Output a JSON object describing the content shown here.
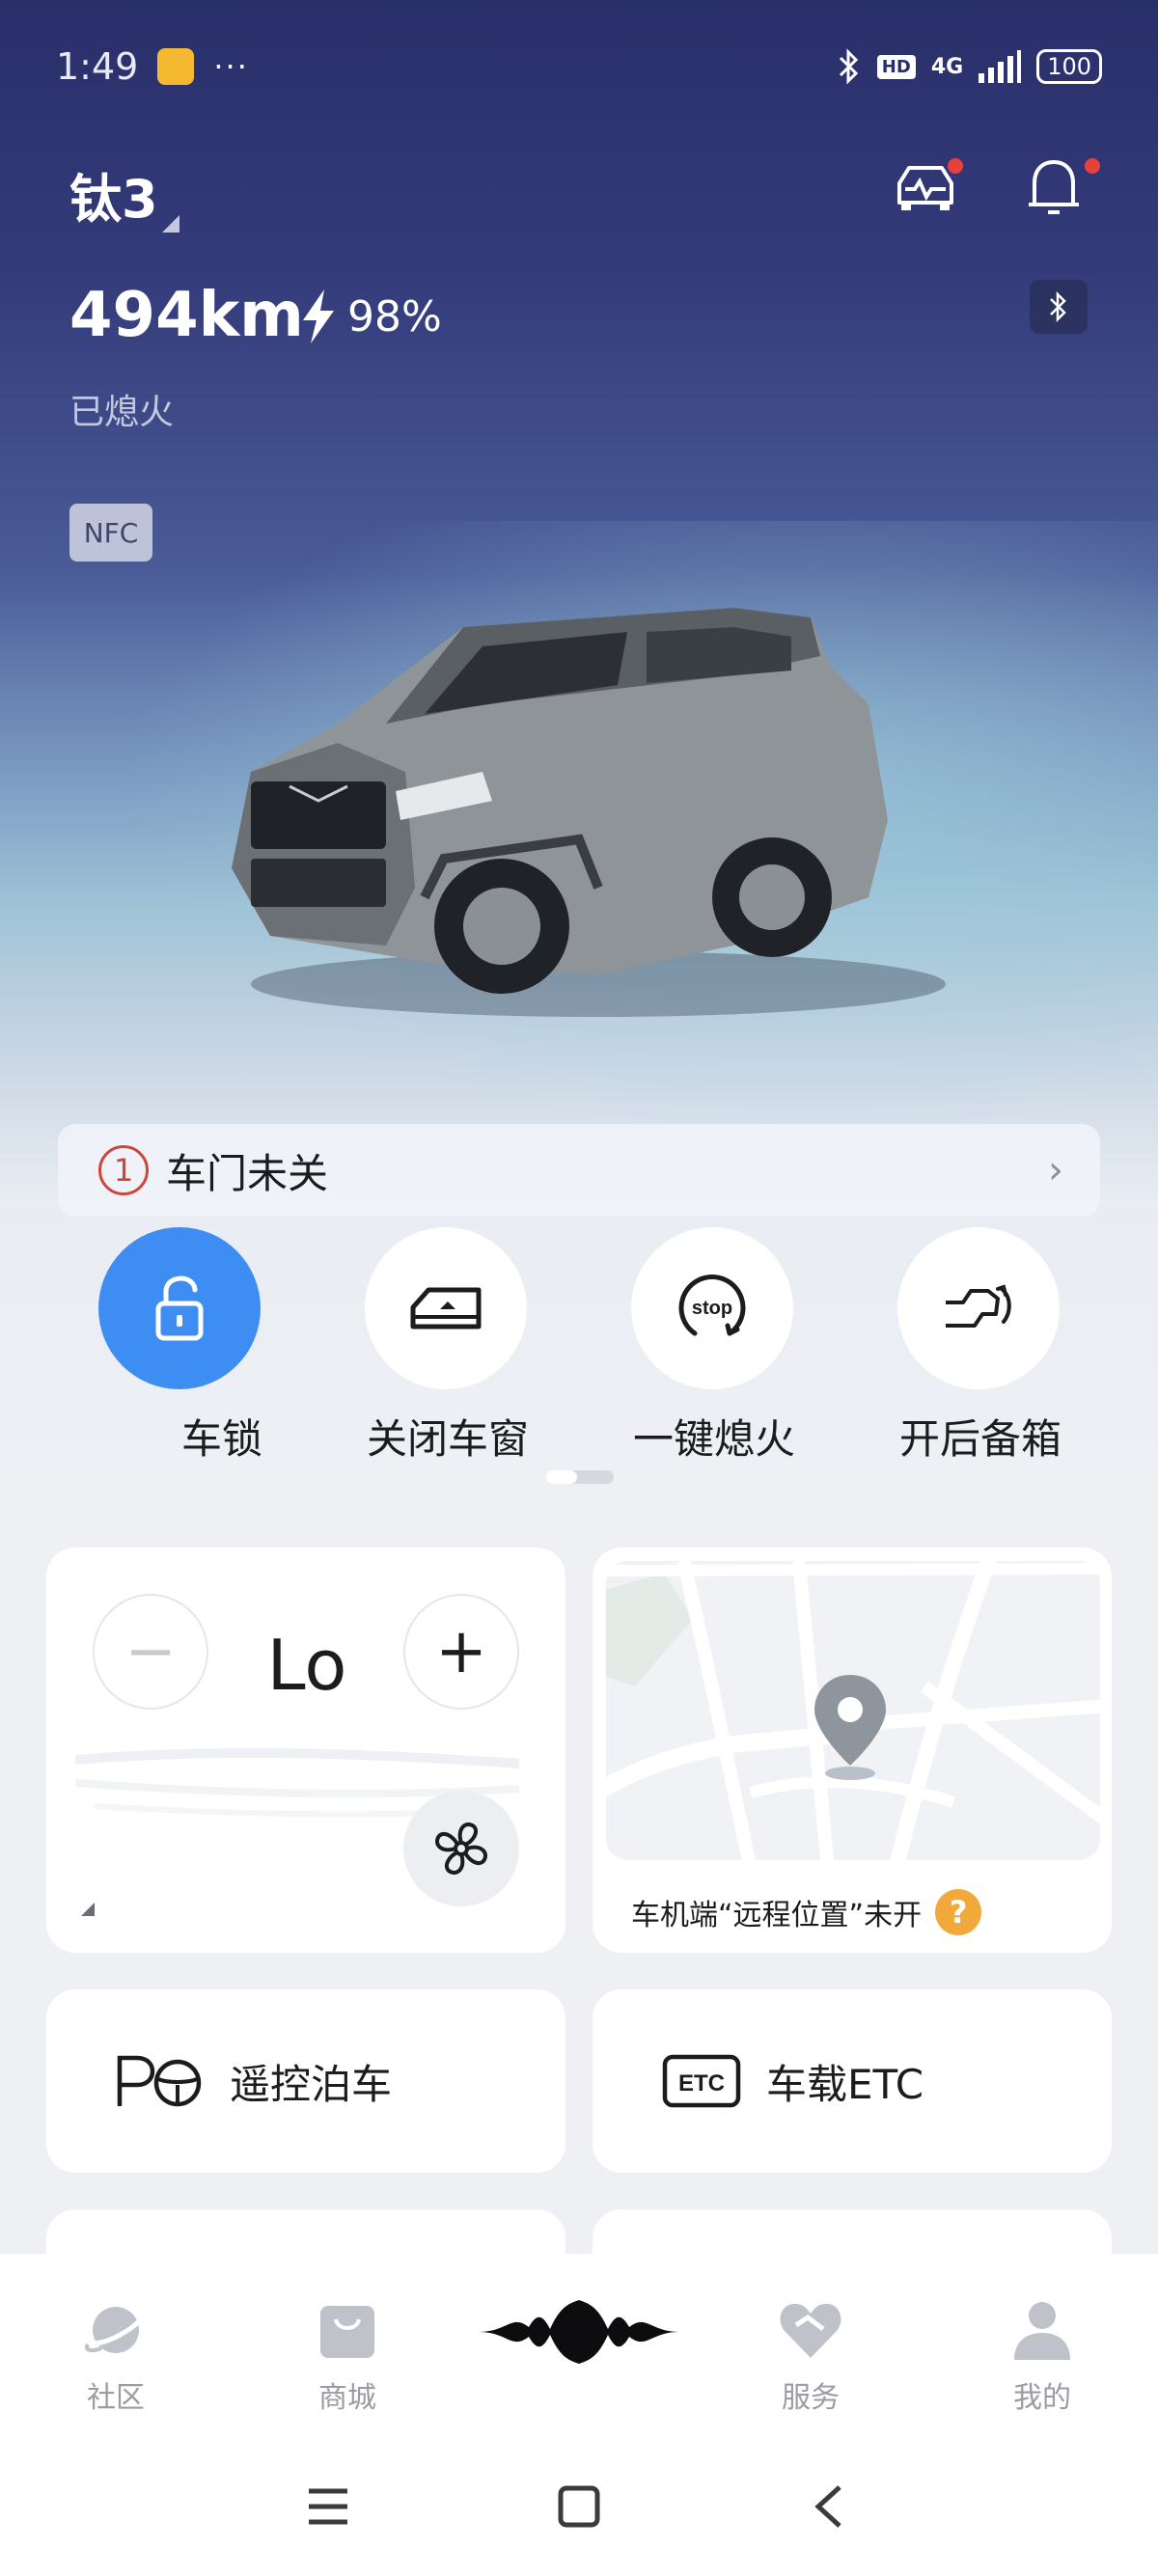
{
  "status_bar": {
    "time": "1:49",
    "dots": "···",
    "hd": "HD",
    "network": "4G",
    "battery": "100"
  },
  "header": {
    "car_name": "钛3"
  },
  "vehicle": {
    "range": "494km",
    "charge": "98%",
    "state": "已熄火",
    "nfc": "NFC"
  },
  "alert": {
    "count": "1",
    "text": "车门未关",
    "chevron": "›"
  },
  "quick_actions": [
    {
      "label": "车锁",
      "active": true
    },
    {
      "label": "关闭车窗"
    },
    {
      "label": "一键熄火",
      "icon_text": "stop"
    },
    {
      "label": "开后备箱"
    }
  ],
  "climate": {
    "minus": "−",
    "plus": "+",
    "level": "Lo"
  },
  "location": {
    "caption": "车机端“远程位置”未开",
    "help": "?"
  },
  "features": [
    {
      "label": "遥控泊车"
    },
    {
      "label": "车载ETC",
      "icon_text": "ETC"
    }
  ],
  "bottom_nav": [
    {
      "label": "社区"
    },
    {
      "label": "商城"
    },
    {
      "label": ""
    },
    {
      "label": "服务"
    },
    {
      "label": "我的"
    }
  ],
  "colors": {
    "accent": "#3e8df2",
    "alert_red": "#d0453b",
    "help_orange": "#f2a93b"
  },
  "icons": [
    "bluetooth-icon",
    "vehicle-status-icon",
    "bell-icon",
    "bolt-icon",
    "lock-open-icon",
    "window-icon",
    "stop-icon",
    "trunk-icon",
    "fan-icon",
    "map-pin-icon",
    "park-icon",
    "etc-icon",
    "planet-icon",
    "bag-icon",
    "brand-logo-icon",
    "service-icon",
    "profile-icon",
    "menu-icon",
    "home-icon",
    "back-icon"
  ]
}
